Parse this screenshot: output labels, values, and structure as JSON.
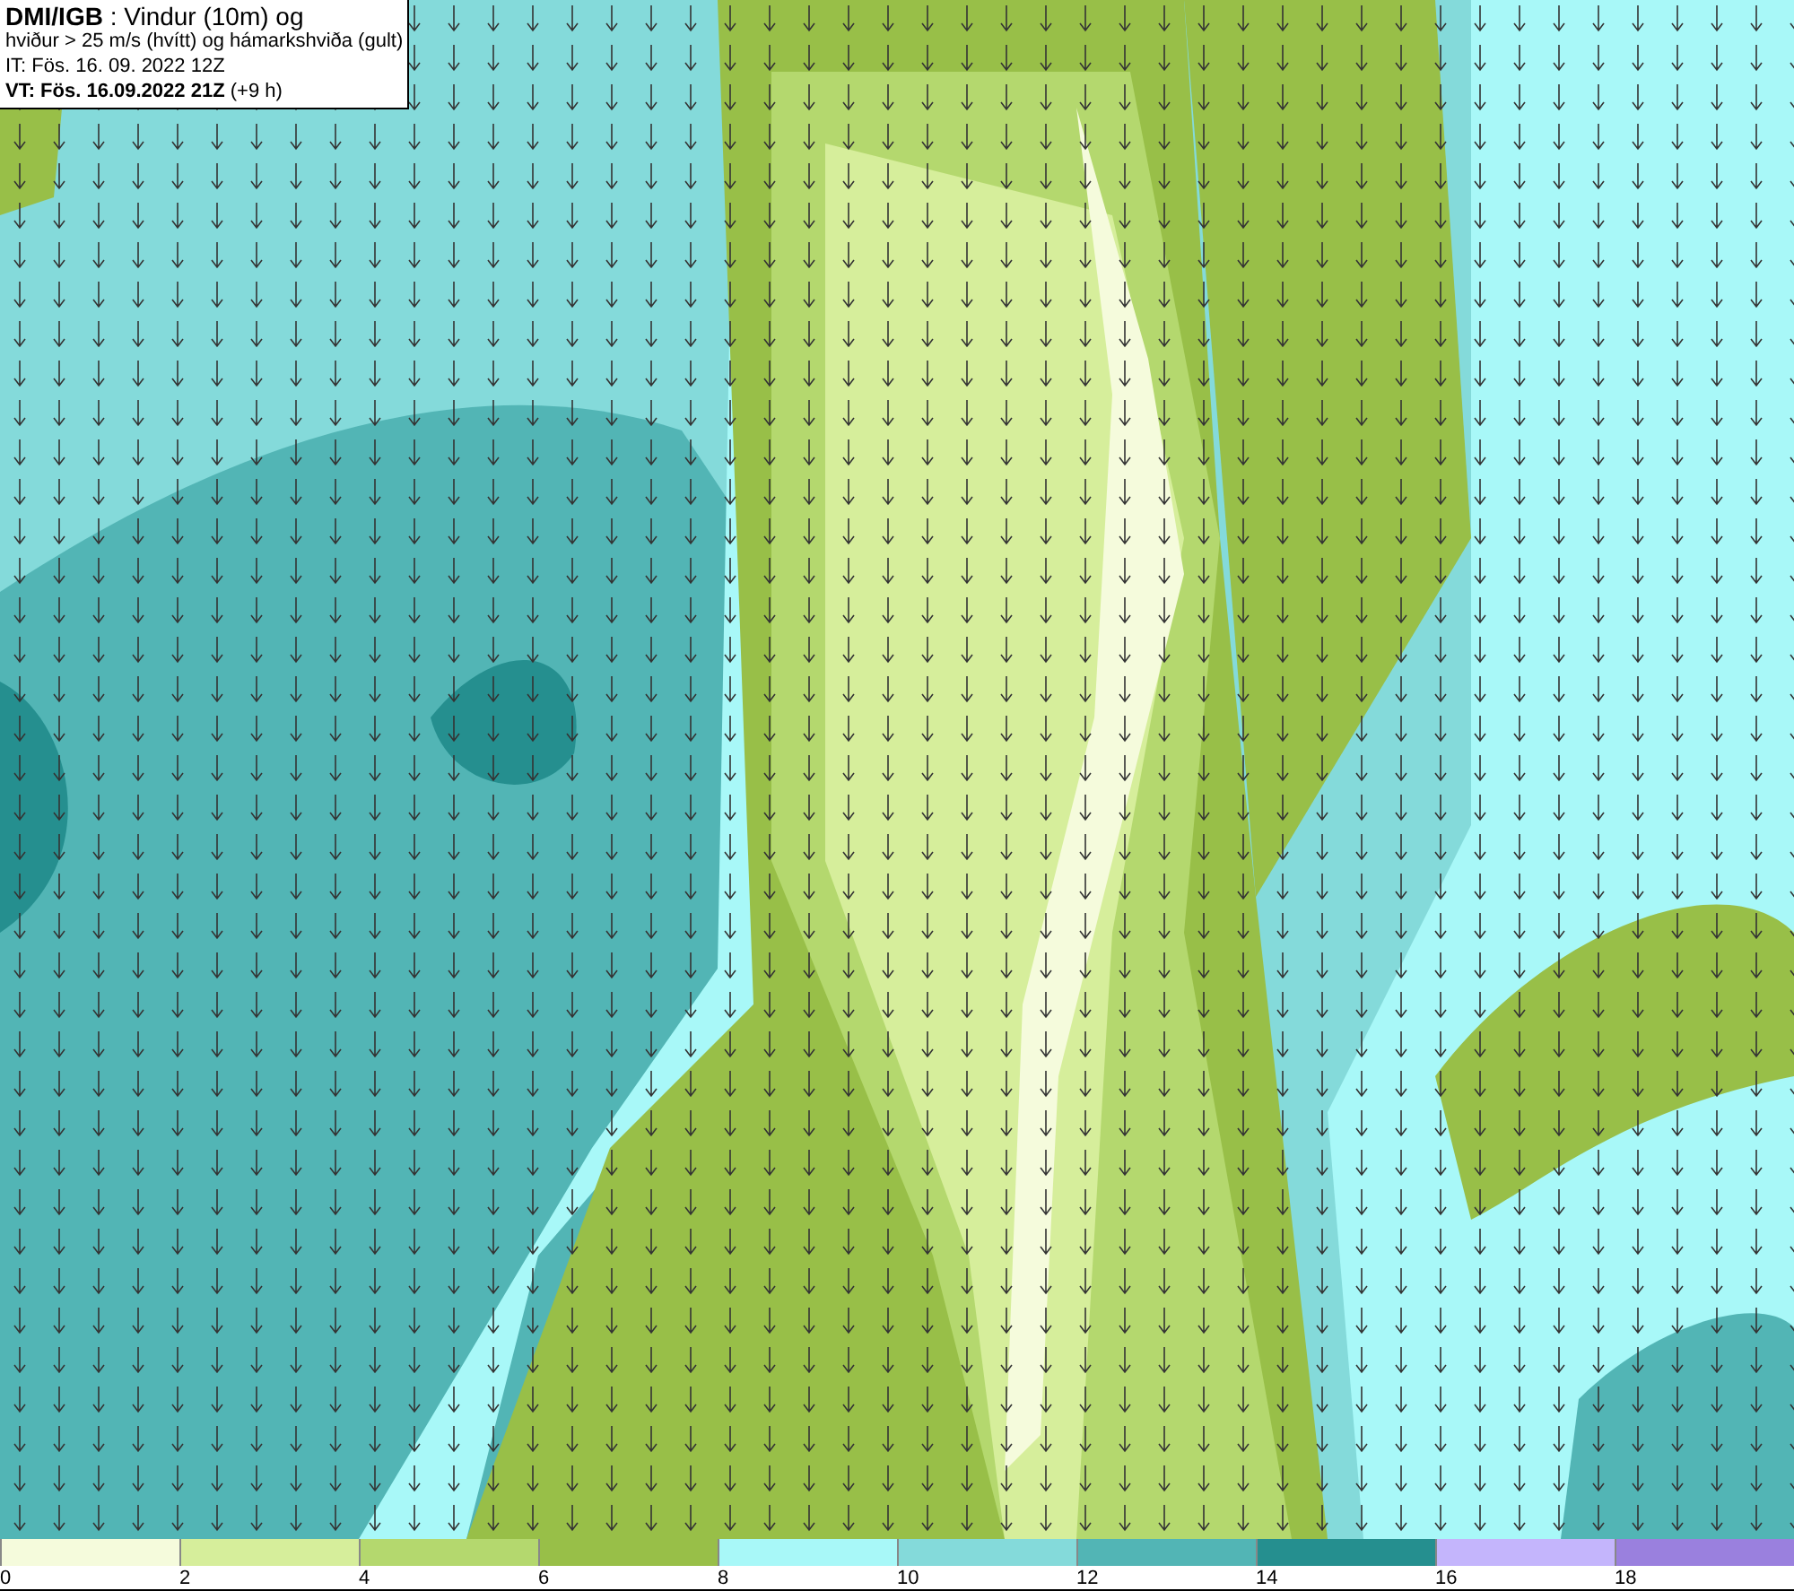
{
  "header": {
    "lines": [
      "**DMI/IGB** : Vindur (10m) og",
      "hviður > 25 m/s (hvítt) og hámarkshviða (gult)",
      "IT: Fös. 16. 09. 2022 12Z",
      "**VT: Fös. 16.09.2022 21Z** (+9 h)"
    ]
  },
  "legend": {
    "swatches": [
      {
        "color": "#f5fbdc"
      },
      {
        "color": "#d6ee9b"
      },
      {
        "color": "#b4d86e"
      },
      {
        "color": "#98bf48"
      },
      {
        "color": "#a8f8f8"
      },
      {
        "color": "#84dada"
      },
      {
        "color": "#52b5b5"
      },
      {
        "color": "#258f8f"
      },
      {
        "color": "#c4b5fc"
      },
      {
        "color": "#9a80de"
      }
    ],
    "labels": [
      "0",
      "2",
      "4",
      "6",
      "8",
      "10",
      "12",
      "14",
      "16",
      "18"
    ]
  }
}
